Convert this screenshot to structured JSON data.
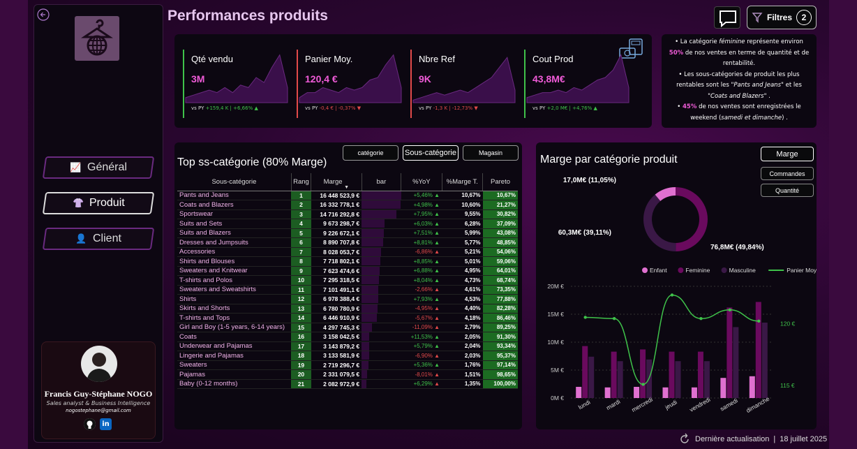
{
  "page": {
    "title": "Performances produits"
  },
  "header": {
    "filters_label": "Filtres",
    "filters_count": "2"
  },
  "nav": {
    "items": [
      {
        "label": "Général",
        "icon": "chart-icon"
      },
      {
        "label": "Produit",
        "icon": "shirt-icon"
      },
      {
        "label": "Client",
        "icon": "user-icon"
      }
    ]
  },
  "profile": {
    "name": "Francis Guy-Stéphane NOGO",
    "role": "Sales analyst & Business Intelligence",
    "email": "nogostephane@gmail.com"
  },
  "kpis": [
    {
      "label": "Qté vendu",
      "value": "3M",
      "vs": "vs PY",
      "delta": "+159,4 K | +6,66%",
      "trend": "up",
      "color": "#3fc24a"
    },
    {
      "label": "Panier Moy.",
      "value": "120,4 €",
      "vs": "vs PY",
      "delta": "-0,4 € | -0,37%",
      "trend": "down",
      "color": "#e24a4a"
    },
    {
      "label": "Nbre Ref",
      "value": "9K",
      "vs": "vs PY",
      "delta": "-1,3 K | -12,73%",
      "trend": "down",
      "color": "#e24a4a"
    },
    {
      "label": "Cout Prod",
      "value": "43,8M€",
      "vs": "vs PY",
      "delta": "+2,0 M€ | +4,76%",
      "trend": "up",
      "color": "#3fc24a"
    }
  ],
  "notes": {
    "n1a": "La catégorie ",
    "n1b": "féminine",
    "n1c": " représente environ ",
    "n1d": "50%",
    "n1e": " de nos ventes en terme de quantité et de rentabilité.",
    "n2a": "Les sous-catégories de produit les plus rentables sont les \"",
    "n2b": "Pants and Jeans",
    "n2c": "\" et les \"",
    "n2d": "Coats and Blazers",
    "n2e": "\" .",
    "n3a": "45%",
    "n3b": " de nos ventes sont enregistrées le weekend (",
    "n3c": "samedi et dimanche",
    "n3d": ") ."
  },
  "table": {
    "tabs": [
      "catégorie",
      "Sous-catégorie",
      "Magasin"
    ],
    "title": "Top ss-catégorie (80% Marge)",
    "headers": [
      "Sous-catégorie",
      "Rang",
      "Marge",
      "bar",
      "%YoY",
      "%Marge T.",
      "Pareto"
    ],
    "rows": [
      [
        "Pants and Jeans",
        "1",
        "16 448 523,9 €",
        1.0,
        "+5,46%",
        "up",
        "10,67%",
        "10,67%"
      ],
      [
        "Coats and Blazers",
        "2",
        "16 332 778,1 €",
        0.99,
        "+4,98%",
        "up",
        "10,60%",
        "21,27%"
      ],
      [
        "Sportswear",
        "3",
        "14 716 292,8 €",
        0.89,
        "+7,95%",
        "up",
        "9,55%",
        "30,82%"
      ],
      [
        "Suits and Sets",
        "4",
        "9 673 298,7 €",
        0.59,
        "+6,03%",
        "up",
        "6,28%",
        "37,09%"
      ],
      [
        "Suits and Blazers",
        "5",
        "9 226 672,1 €",
        0.56,
        "+7,51%",
        "up",
        "5,99%",
        "43,08%"
      ],
      [
        "Dresses and Jumpsuits",
        "6",
        "8 890 707,8 €",
        0.54,
        "+8,81%",
        "up",
        "5,77%",
        "48,85%"
      ],
      [
        "Accessories",
        "7",
        "8 028 053,7 €",
        0.49,
        "-6,86%",
        "down",
        "5,21%",
        "54,06%"
      ],
      [
        "Shirts and Blouses",
        "8",
        "7 718 802,1 €",
        0.47,
        "+8,85%",
        "up",
        "5,01%",
        "59,06%"
      ],
      [
        "Sweaters and Knitwear",
        "9",
        "7 623 474,6 €",
        0.46,
        "+6,88%",
        "up",
        "4,95%",
        "64,01%"
      ],
      [
        "T-shirts and Polos",
        "10",
        "7 295 318,5 €",
        0.44,
        "+8,04%",
        "up",
        "4,73%",
        "68,74%"
      ],
      [
        "Sweaters and Sweatshirts",
        "11",
        "7 101 491,1 €",
        0.43,
        "-2,66%",
        "down",
        "4,61%",
        "73,35%"
      ],
      [
        "Shirts",
        "12",
        "6 978 388,4 €",
        0.42,
        "+7,93%",
        "up",
        "4,53%",
        "77,88%"
      ],
      [
        "Skirts and Shorts",
        "13",
        "6 780 780,9 €",
        0.41,
        "-4,95%",
        "down",
        "4,40%",
        "82,28%"
      ],
      [
        "T-shirts and Tops",
        "14",
        "6 446 910,9 €",
        0.39,
        "-5,67%",
        "down",
        "4,18%",
        "86,46%"
      ],
      [
        "Girl and Boy (1-5 years, 6-14 years)",
        "15",
        "4 297 745,3 €",
        0.26,
        "-11,09%",
        "down",
        "2,79%",
        "89,25%"
      ],
      [
        "Coats",
        "16",
        "3 158 042,5 €",
        0.19,
        "+11,53%",
        "up",
        "2,05%",
        "91,30%"
      ],
      [
        "Underwear and Pajamas",
        "17",
        "3 143 879,2 €",
        0.19,
        "+5,79%",
        "up",
        "2,04%",
        "93,34%"
      ],
      [
        "Lingerie and Pajamas",
        "18",
        "3 133 581,9 €",
        0.19,
        "-6,90%",
        "down",
        "2,03%",
        "95,37%"
      ],
      [
        "Sweaters",
        "19",
        "2 719 296,7 €",
        0.17,
        "+5,36%",
        "up",
        "1,76%",
        "97,14%"
      ],
      [
        "Pajamas",
        "20",
        "2 331 079,5 €",
        0.14,
        "-8,01%",
        "down",
        "1,51%",
        "98,65%"
      ],
      [
        "Baby (0-12 months)",
        "21",
        "2 082 972,9 €",
        0.13,
        "+6,29%",
        "down",
        "1,35%",
        "100,00%"
      ]
    ]
  },
  "chart_panel": {
    "title": "Marge par catégorie produit",
    "buttons": [
      "Marge",
      "Commandes",
      "Quantité"
    ]
  },
  "chart_data": [
    {
      "type": "pie",
      "labels": [
        "Feminine",
        "Masculine",
        "Enfant"
      ],
      "values": [
        76.8,
        60.3,
        17.0
      ],
      "data_labels": [
        "76,8M€ (49,84%)",
        "60,3M€ (39,11%)",
        "17,0M€ (11,05%)"
      ],
      "colors": [
        "#6a0a5e",
        "#3a1846",
        "#e070d0"
      ]
    },
    {
      "type": "bar",
      "categories": [
        "lundi",
        "mardi",
        "mercredi",
        "jeudi",
        "vendredi",
        "samedi",
        "dimanche"
      ],
      "series": [
        {
          "name": "Enfant",
          "values": [
            2.0,
            1.9,
            2.0,
            1.9,
            1.9,
            3.6,
            3.9
          ],
          "color": "#e070d0"
        },
        {
          "name": "Feminine",
          "values": [
            9.3,
            8.3,
            8.7,
            8.3,
            8.3,
            16.2,
            17.2
          ],
          "color": "#6a0a5e"
        },
        {
          "name": "Masculine",
          "values": [
            7.4,
            6.6,
            6.9,
            6.6,
            6.6,
            12.7,
            13.5
          ],
          "color": "#3a1846"
        },
        {
          "name": "Panier Moy.",
          "values": [
            120.5,
            120.4,
            115.1,
            122.3,
            120.4,
            121.1,
            120.2
          ],
          "color": "#3fc24a",
          "kind": "line"
        }
      ],
      "y_ticks": [
        "0M €",
        "5M €",
        "10M €",
        "15M €",
        "20M €"
      ],
      "ylim": [
        0,
        20
      ],
      "y2_ticks": [
        "115 €",
        "120 €"
      ],
      "y2lim": [
        114,
        123
      ]
    }
  ],
  "footer": {
    "label": "Dernière actualisation",
    "date": "18 juillet 2025"
  }
}
